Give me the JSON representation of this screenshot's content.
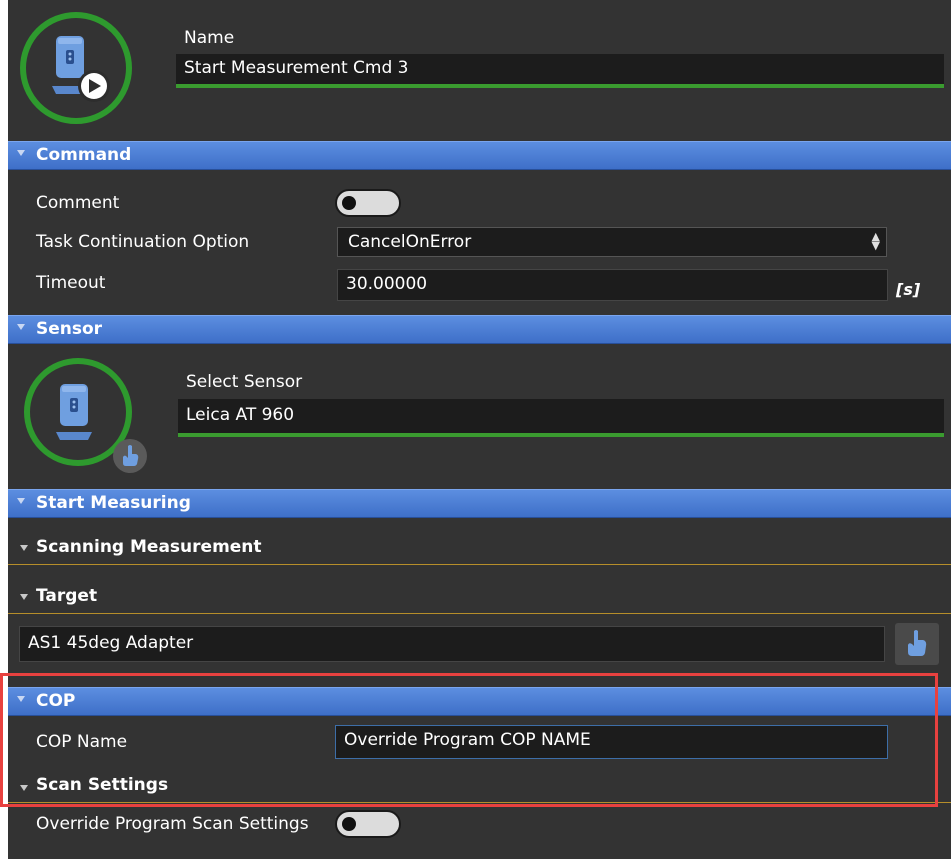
{
  "header": {
    "name_label": "Name",
    "name_value": "Start Measurement Cmd 3"
  },
  "command": {
    "title": "Command",
    "comment_label": "Comment",
    "task_label": "Task Continuation Option",
    "task_value": "CancelOnError",
    "timeout_label": "Timeout",
    "timeout_value": "30.00000",
    "timeout_unit": "[s]"
  },
  "sensor": {
    "title": "Sensor",
    "select_label": "Select Sensor",
    "select_value": "Leica AT 960"
  },
  "start_measuring": {
    "title": "Start Measuring",
    "scanning_title": "Scanning Measurement",
    "target_title": "Target",
    "target_value": "AS1 45deg Adapter"
  },
  "cop": {
    "title": "COP",
    "name_label": "COP Name",
    "name_value": "Override Program COP NAME"
  },
  "scan_settings": {
    "title": "Scan Settings",
    "override_label": "Override Program Scan Settings"
  },
  "icons": {
    "header_icon": "tracker-play-icon",
    "sensor_icon": "tracker-icon",
    "pick_icon": "hand-pointer-icon"
  },
  "colors": {
    "accent_green": "#2e9a2e",
    "section_blue": "#4a7bd2",
    "divider_gold": "#b68e2a",
    "highlight_red": "#e8413f",
    "icon_blue": "#6f9fe0"
  }
}
